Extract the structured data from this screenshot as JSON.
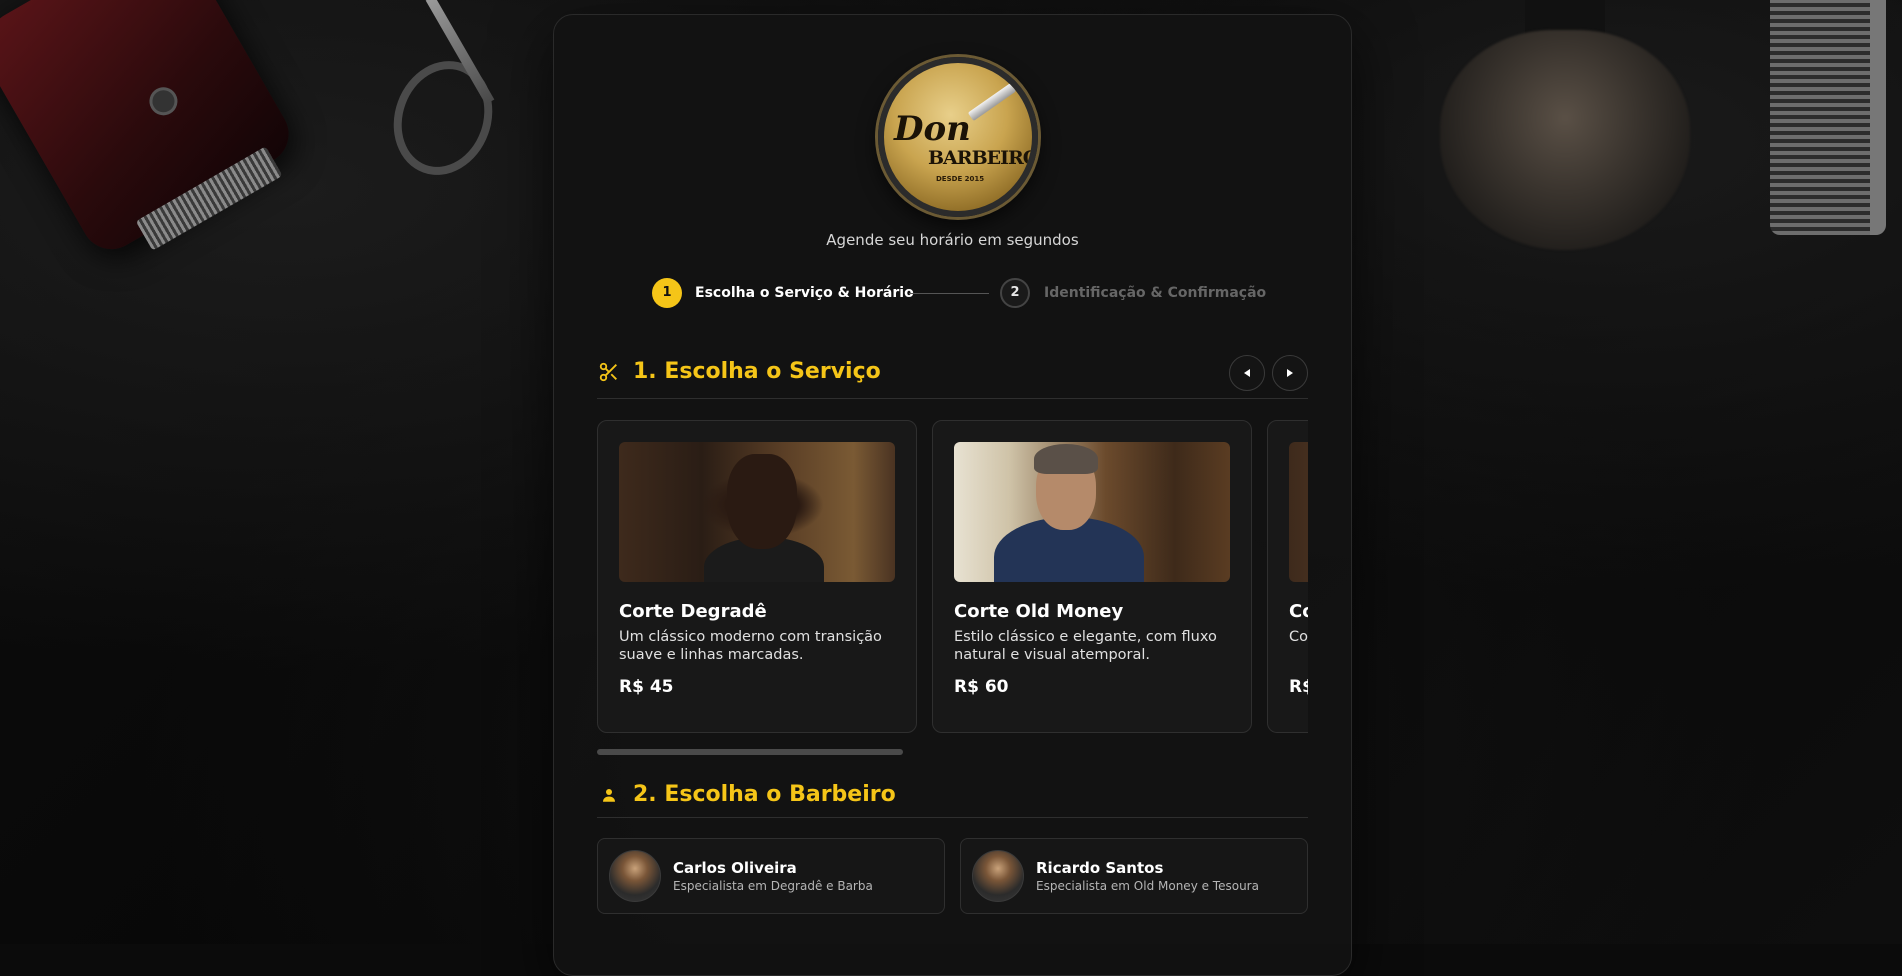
{
  "brand": {
    "logo_text_top": "Don",
    "logo_text_main": "BARBEIRO",
    "logo_since": "DESDE 2015",
    "tagline": "Agende seu horário em segundos"
  },
  "stepper": [
    {
      "number": "1",
      "label": "Escolha o Serviço & Horário",
      "active": true
    },
    {
      "number": "2",
      "label": "Identificação & Confirmação",
      "active": false
    }
  ],
  "services_section": {
    "title": "1. Escolha o Serviço",
    "icon": "scissors-icon"
  },
  "services": [
    {
      "title": "Corte Degradê",
      "description": "Um clássico moderno com transição suave e linhas marcadas.",
      "price": "R$ 45"
    },
    {
      "title": "Corte Old Money",
      "description": "Estilo clássico e elegante, com fluxo natural e visual atemporal.",
      "price": "R$ 60"
    },
    {
      "title": "Co",
      "description": "Co dia",
      "price": "R$"
    }
  ],
  "barbers_section": {
    "title": "2. Escolha o Barbeiro",
    "icon": "person-icon"
  },
  "barbers": [
    {
      "name": "Carlos Oliveira",
      "specialty": "Especialista em Degradê e Barba"
    },
    {
      "name": "Ricardo Santos",
      "specialty": "Especialista em Old Money e Tesoura"
    }
  ],
  "colors": {
    "accent": "#f5c518",
    "panel": "#121212",
    "card": "#181818"
  }
}
